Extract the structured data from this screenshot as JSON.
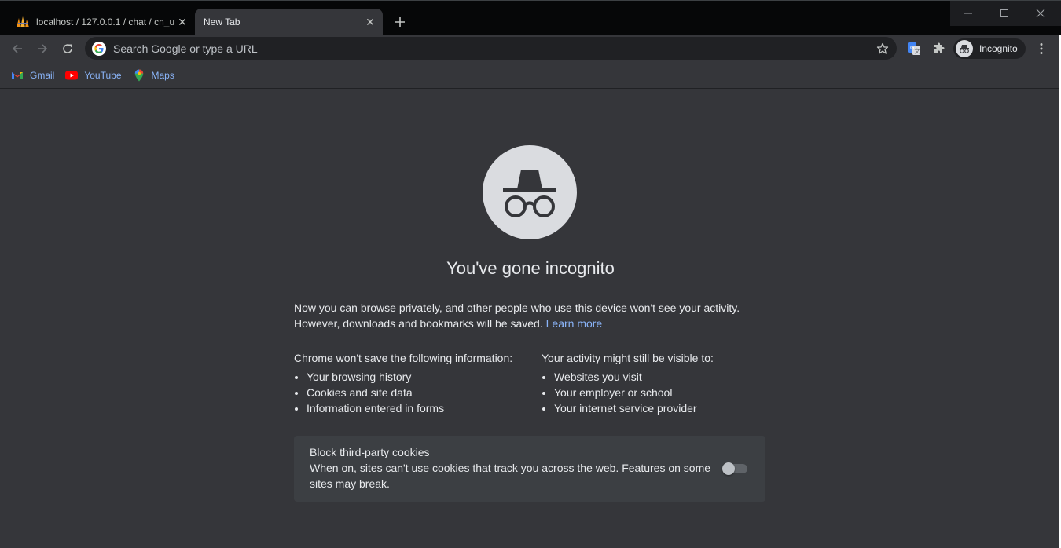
{
  "tabs": [
    {
      "title": "localhost / 127.0.0.1 / chat / cn_u",
      "active": false
    },
    {
      "title": "New Tab",
      "active": true
    }
  ],
  "omnibox": {
    "placeholder": "Search Google or type a URL"
  },
  "profile": {
    "label": "Incognito"
  },
  "bookmarks": [
    {
      "label": "Gmail",
      "icon": "gmail-icon"
    },
    {
      "label": "YouTube",
      "icon": "youtube-icon"
    },
    {
      "label": "Maps",
      "icon": "maps-icon"
    }
  ],
  "page": {
    "headline": "You've gone incognito",
    "intro_line1": "Now you can browse privately, and other people who use this device won't see your activity.",
    "intro_line2": "However, downloads and bookmarks will be saved.",
    "learn_more": "Learn more",
    "left_heading": "Chrome won't save the following information:",
    "left_items": [
      "Your browsing history",
      "Cookies and site data",
      "Information entered in forms"
    ],
    "right_heading": "Your activity might still be visible to:",
    "right_items": [
      "Websites you visit",
      "Your employer or school",
      "Your internet service provider"
    ],
    "cookies_title": "Block third-party cookies",
    "cookies_desc": "When on, sites can't use cookies that track you across the web. Features on some sites may break.",
    "cookies_enabled": false
  },
  "colors": {
    "background": "#35363a",
    "link": "#8ab4f8",
    "tabstrip": "#060708"
  }
}
